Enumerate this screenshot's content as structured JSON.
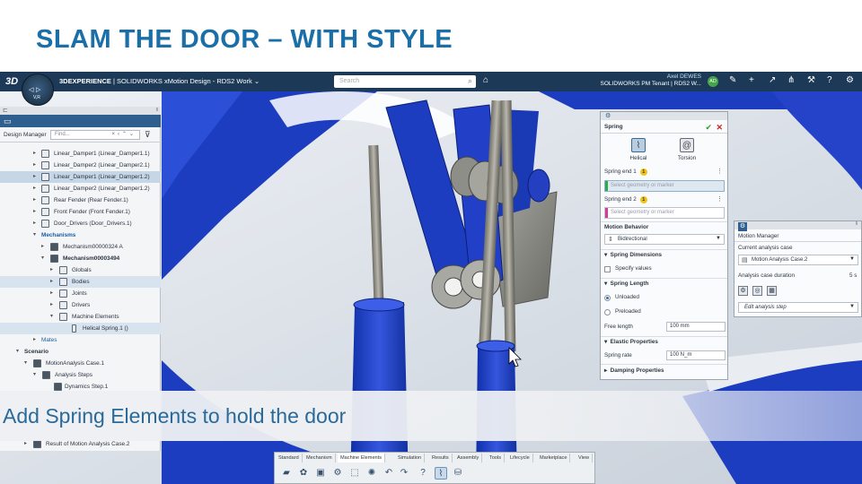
{
  "slide": {
    "title": "SLAM THE DOOR – WITH STYLE"
  },
  "topbar": {
    "logo": "3D",
    "brand_bold": "3DEXPERIENCE",
    "brand_rest": " | SOLIDWORKS xMotion Design - RDS2 Work",
    "search_placeholder": "Search",
    "user_name": "Axel DEWES",
    "user_sub": "SOLIDWORKS PM Tenant | RDS2 W...",
    "avatar": "AD",
    "compass_label": "V,R"
  },
  "tree": {
    "header_label": "Design Manager",
    "find_placeholder": "Find...",
    "rows": [
      {
        "text": "Linear_Damper1 (Linear_Damper1.1)"
      },
      {
        "text": "Linear_Damper2 (Linear_Damper2.1)"
      },
      {
        "text": "Linear_Damper1 (Linear_Damper1.2)"
      },
      {
        "text": "Linear_Damper2 (Linear_Damper1.2)"
      },
      {
        "text": "Rear Fender (Rear Fender.1)"
      },
      {
        "text": "Front Fender (Front Fender.1)"
      },
      {
        "text": "Door_Drivers (Door_Drivers.1)"
      },
      {
        "text": "Mechanisms"
      },
      {
        "text": "Mechanism00000324 A"
      },
      {
        "text": "Mechanism00003494"
      },
      {
        "text": "Globals"
      },
      {
        "text": "Bodies"
      },
      {
        "text": "Joints"
      },
      {
        "text": "Drivers"
      },
      {
        "text": "Machine Elements"
      },
      {
        "text": "Helical Spring.1 ()"
      },
      {
        "text": "Mates"
      },
      {
        "text": "Scenario"
      },
      {
        "text": "MotionAnalysis Case.1"
      },
      {
        "text": "Analysis Steps"
      },
      {
        "text": "Dynamics Step.1"
      },
      {
        "text": "Result of Motion Analysis Case.2"
      }
    ]
  },
  "spring": {
    "title": "Spring",
    "type_helical": "Helical",
    "type_torsion": "Torsion",
    "end1_label": "Spring end 1",
    "end1_badge": "1",
    "end1_placeholder": "Select geometry or marker",
    "end2_label": "Spring end 2",
    "end2_badge": "1",
    "end2_placeholder": "Select geometry or marker",
    "behavior_label": "Motion Behavior",
    "behavior_value": "Bidirectional",
    "dims_section": "Spring Dimensions",
    "specify_values": "Specify values",
    "length_section": "Spring Length",
    "unloaded": "Unloaded",
    "preloaded": "Preloaded",
    "free_length_label": "Free length",
    "free_length_value": "100 mm",
    "elastic_section": "Elastic Properties",
    "spring_rate_label": "Spring rate",
    "spring_rate_value": "100 N_m",
    "damping_section": "Damping Properties"
  },
  "motion_manager": {
    "title": "Motion Manager",
    "current_case_label": "Current analysis case",
    "current_case_value": "Motion Analysis Case.2",
    "duration_label": "Analysis case duration",
    "duration_value": "5 s",
    "edit_step": "Edit analysis step"
  },
  "caption": {
    "text": "Add Spring Elements to hold the door"
  },
  "viewport": {
    "view_pill": "mm"
  },
  "toolbar": {
    "tabs": [
      "Standard",
      "Mechanism",
      "Machine Elements",
      "Simulation",
      "Results",
      "Assembly",
      "Tools",
      "Lifecycle",
      "Marketplace",
      "View"
    ],
    "selected_tab": "Machine Elements"
  },
  "colors": {
    "accent": "#1a6fa8",
    "topbar": "#1c3a57",
    "part_blue": "#1f3fc4",
    "rod_gray": "#8d8d86",
    "end1_bar": "#2fa84f",
    "end2_bar": "#d63aa0"
  }
}
